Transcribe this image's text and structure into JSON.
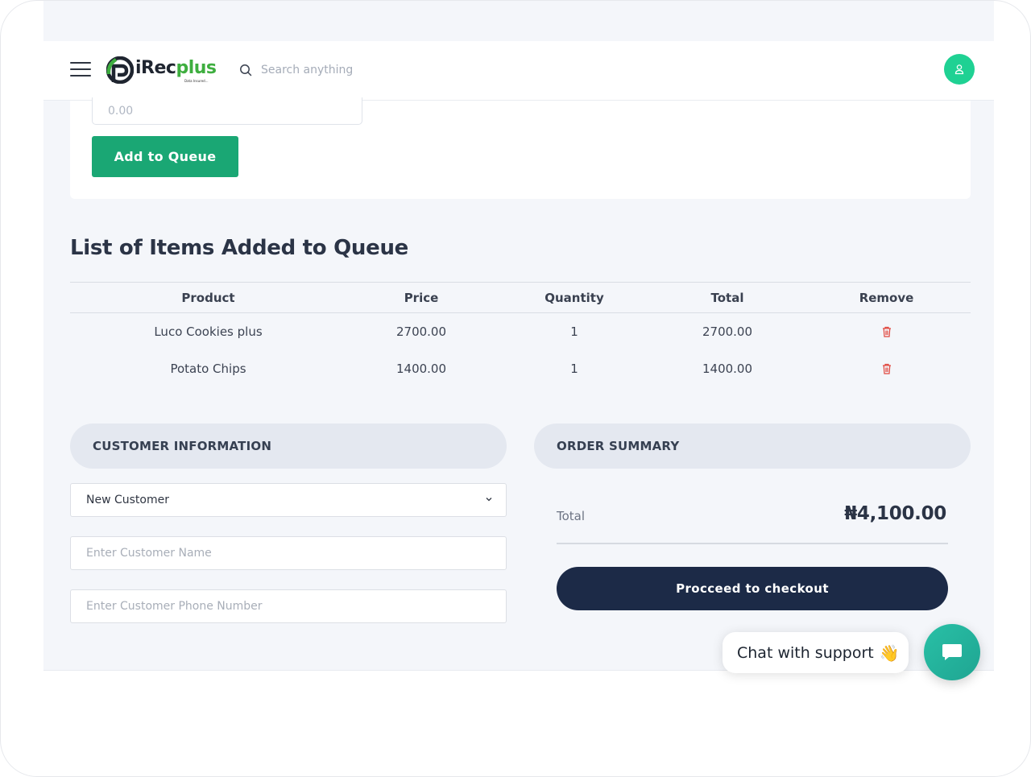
{
  "header": {
    "brand_main": "iRec",
    "brand_accent": "plus",
    "brand_tagline": "Data Insured...",
    "search_placeholder": "Search anything"
  },
  "form": {
    "amount_placeholder": "0.00",
    "add_button_label": "Add to Queue"
  },
  "queue": {
    "title": "List of Items Added to Queue",
    "columns": [
      "Product",
      "Price",
      "Quantity",
      "Total",
      "Remove"
    ],
    "rows": [
      {
        "product": "Luco Cookies plus",
        "price": "2700.00",
        "quantity": "1",
        "total": "2700.00"
      },
      {
        "product": "Potato Chips",
        "price": "1400.00",
        "quantity": "1",
        "total": "1400.00"
      }
    ]
  },
  "customer": {
    "heading": "CUSTOMER INFORMATION",
    "customer_type_selected": "New Customer",
    "name_placeholder": "Enter Customer Name",
    "phone_placeholder": "Enter Customer Phone Number"
  },
  "order": {
    "heading": "ORDER SUMMARY",
    "total_label": "Total",
    "total_value": "₦4,100.00",
    "checkout_label": "Procceed to checkout"
  },
  "chat": {
    "label": "Chat with support",
    "emoji": "👋"
  },
  "colors": {
    "accent_green": "#1aa774",
    "avatar_green": "#1fd193",
    "navy": "#1c2a47",
    "danger_red": "#e0463d",
    "chat_teal": "#29c0a6"
  }
}
